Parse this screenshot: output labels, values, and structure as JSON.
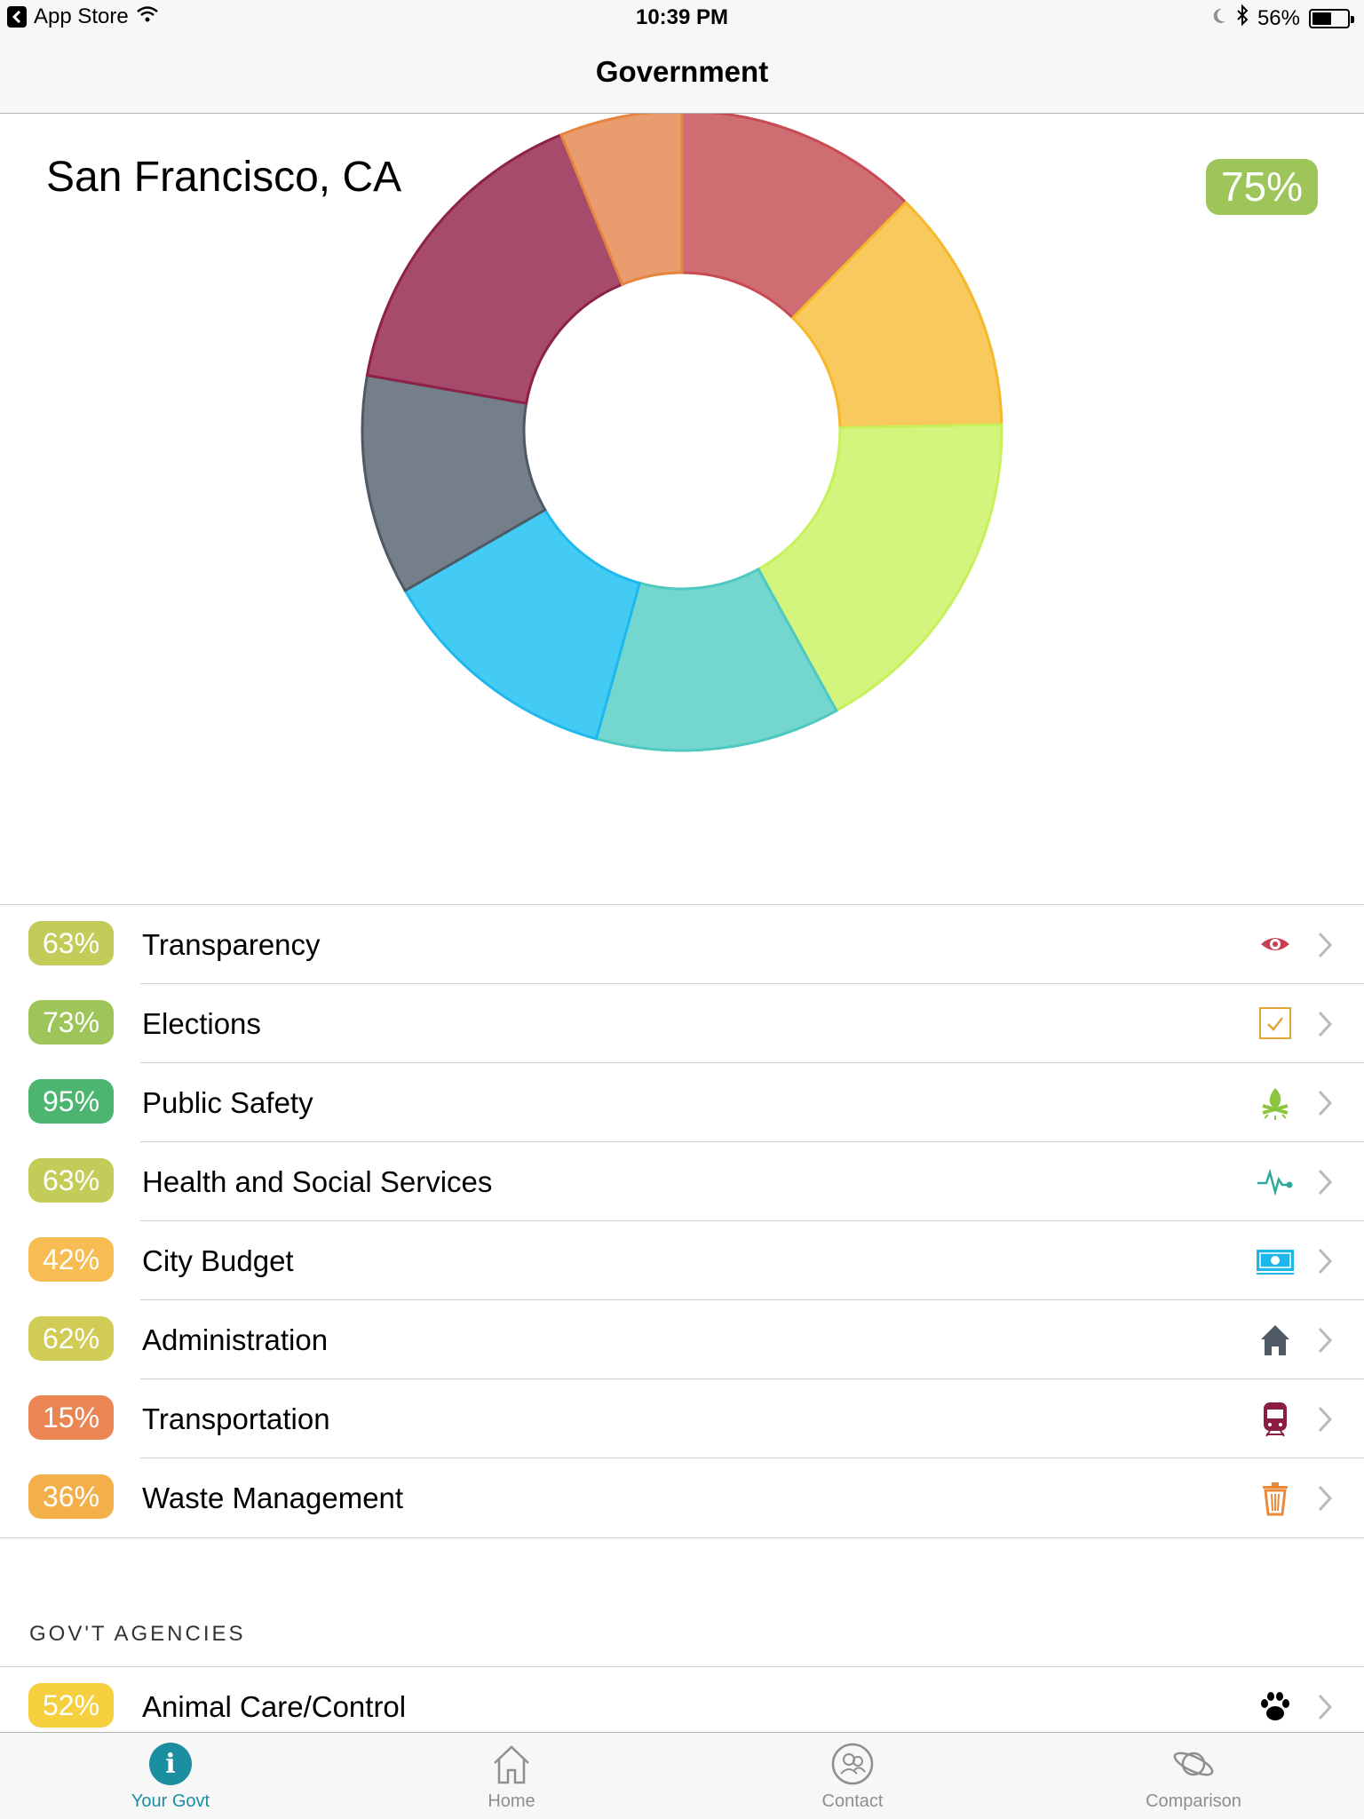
{
  "status_bar": {
    "back_app": "App Store",
    "time": "10:39 PM",
    "battery": "56%",
    "battery_level": 0.56
  },
  "nav": {
    "title": "Government"
  },
  "city": {
    "name": "San Francisco, CA",
    "score": "75%",
    "score_color": "#9dc55a"
  },
  "chart_data": {
    "type": "pie",
    "variant": "donut",
    "values": [
      10,
      10,
      14,
      10,
      10,
      9,
      13,
      5
    ],
    "colors": [
      "#ce6e72",
      "#f8ca5d",
      "#d3f57d",
      "#73d6cf",
      "#43cbf4",
      "#757f89",
      "#a74b6d",
      "#e99d6e"
    ],
    "stroke_colors": [
      "#c74a55",
      "#f5b82a",
      "#c6f15a",
      "#4dc9c2",
      "#1fb8ee",
      "#4e5966",
      "#8e2149",
      "#e4843f"
    ]
  },
  "categories": [
    {
      "percent": "63%",
      "label": "Transparency",
      "color": "#c3cc59",
      "icon": "eye-icon",
      "icon_color": "#c7404f"
    },
    {
      "percent": "73%",
      "label": "Elections",
      "color": "#9dc55a",
      "icon": "checkbox-icon",
      "icon_color": "#e0a33a"
    },
    {
      "percent": "95%",
      "label": "Public Safety",
      "color": "#4cb56f",
      "icon": "campfire-icon",
      "icon_color": "#8cc63e"
    },
    {
      "percent": "63%",
      "label": "Health and Social Services",
      "color": "#c3cc59",
      "icon": "heartbeat-icon",
      "icon_color": "#2fa99c"
    },
    {
      "percent": "42%",
      "label": "City Budget",
      "color": "#f7bd52",
      "icon": "money-icon",
      "icon_color": "#1eb7ec"
    },
    {
      "percent": "62%",
      "label": "Administration",
      "color": "#d1cc55",
      "icon": "house-icon",
      "icon_color": "#4f5a66"
    },
    {
      "percent": "15%",
      "label": "Transportation",
      "color": "#eb8654",
      "icon": "train-icon",
      "icon_color": "#8b1d45"
    },
    {
      "percent": "36%",
      "label": "Waste Management",
      "color": "#f3b04a",
      "icon": "trash-icon",
      "icon_color": "#e98a3a"
    }
  ],
  "agencies": {
    "header": "GOV'T AGENCIES",
    "items": [
      {
        "percent": "52%",
        "label": "Animal Care/Control",
        "color": "#f5cf3d",
        "icon": "paw-icon",
        "icon_color": "#000000"
      }
    ]
  },
  "tabs": [
    {
      "label": "Your Govt",
      "icon": "info-icon",
      "active": true
    },
    {
      "label": "Home",
      "icon": "home-icon",
      "active": false
    },
    {
      "label": "Contact",
      "icon": "contact-icon",
      "active": false
    },
    {
      "label": "Comparison",
      "icon": "planet-icon",
      "active": false
    }
  ],
  "colors": {
    "tab_active": "#1b8ea0",
    "tab_inactive": "#8e8e93"
  }
}
